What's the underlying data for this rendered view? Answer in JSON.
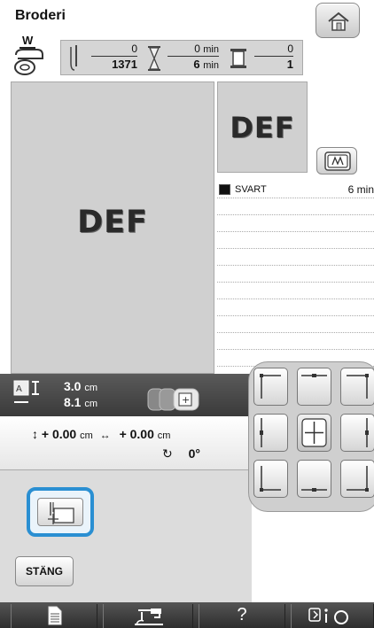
{
  "header": {
    "title": "Broderi",
    "presser_foot_label": "W",
    "stitch_count": {
      "current": "0",
      "total": "1371"
    },
    "time": {
      "current": "0",
      "total": "6",
      "unit": "min"
    },
    "color_count": {
      "current": "0",
      "total": "1"
    }
  },
  "preview": {
    "design_text": "DEF",
    "small_design_text": "DEF"
  },
  "thread_list": [
    {
      "name": "SVART",
      "time": "6 min",
      "color": "#111111"
    }
  ],
  "size": {
    "height_value": "3.0",
    "width_value": "8.1",
    "unit": "cm"
  },
  "offset": {
    "vertical": "+ 0.00",
    "horizontal": "+ 0.00",
    "unit": "cm",
    "rotation": "0°"
  },
  "buttons": {
    "close_label": "STÄNG",
    "help_label": "?"
  },
  "icons": {
    "home": "home-icon",
    "needle": "needle-icon",
    "hourglass": "hourglass-icon",
    "spool": "spool-icon",
    "frame": "frame-icon",
    "start_point": "start-point-icon",
    "document": "document-icon",
    "machine": "machine-icon",
    "settings": "settings-icon"
  }
}
